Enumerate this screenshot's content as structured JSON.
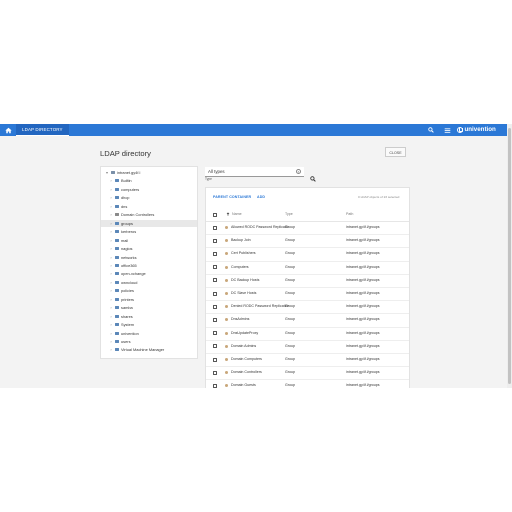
{
  "topbar": {
    "tab_label": "LDAP DIRECTORY",
    "brand": "univention",
    "colors": {
      "bar": "#2b78d6",
      "active_tab": "#2266c0"
    }
  },
  "page": {
    "title": "LDAP directory",
    "close_label": "CLOSE"
  },
  "tree": {
    "items": [
      {
        "label": "intranet.gy4f.l",
        "expanded": true,
        "icon": "domain-icon"
      },
      {
        "label": "Builtin",
        "icon": "folder-icon"
      },
      {
        "label": "computers",
        "icon": "folder-icon"
      },
      {
        "label": "dhcp",
        "icon": "folder-icon"
      },
      {
        "label": "dns",
        "icon": "folder-icon"
      },
      {
        "label": "Domain Controllers",
        "icon": "server-icon"
      },
      {
        "label": "groups",
        "icon": "folder-icon",
        "selected": true
      },
      {
        "label": "kerberos",
        "icon": "folder-icon"
      },
      {
        "label": "mail",
        "icon": "folder-icon"
      },
      {
        "label": "nagios",
        "icon": "folder-icon"
      },
      {
        "label": "networks",
        "icon": "folder-icon"
      },
      {
        "label": "office365",
        "icon": "folder-icon"
      },
      {
        "label": "open-xchange",
        "icon": "folder-icon"
      },
      {
        "label": "owncloud",
        "icon": "folder-icon"
      },
      {
        "label": "policies",
        "icon": "folder-icon"
      },
      {
        "label": "printers",
        "icon": "folder-icon"
      },
      {
        "label": "samba",
        "icon": "folder-icon"
      },
      {
        "label": "shares",
        "icon": "folder-icon"
      },
      {
        "label": "System",
        "icon": "folder-icon"
      },
      {
        "label": "univention",
        "icon": "folder-icon"
      },
      {
        "label": "users",
        "icon": "folder-icon"
      },
      {
        "label": "Virtual Machine Manager",
        "icon": "folder-icon"
      }
    ]
  },
  "filter": {
    "value": "All types",
    "label": "Type"
  },
  "grid": {
    "parent_label": "PARENT CONTAINER",
    "add_label": "ADD",
    "status": "0 LDAP objects of 23 selected",
    "columns": {
      "name": "Name",
      "type": "Type",
      "path": "Path"
    },
    "rows": [
      {
        "name": "Allowed RODC Password Replication Group",
        "type": "Group",
        "path": "intranet.gy4f.l/groups"
      },
      {
        "name": "Backup Join",
        "type": "Group",
        "path": "intranet.gy4f.l/groups"
      },
      {
        "name": "Cert Publishers",
        "type": "Group",
        "path": "intranet.gy4f.l/groups"
      },
      {
        "name": "Computers",
        "type": "Group",
        "path": "intranet.gy4f.l/groups"
      },
      {
        "name": "DC Backup Hosts",
        "type": "Group",
        "path": "intranet.gy4f.l/groups"
      },
      {
        "name": "DC Slave Hosts",
        "type": "Group",
        "path": "intranet.gy4f.l/groups"
      },
      {
        "name": "Denied RODC Password Replication Group",
        "type": "Group",
        "path": "intranet.gy4f.l/groups"
      },
      {
        "name": "DnsAdmins",
        "type": "Group",
        "path": "intranet.gy4f.l/groups"
      },
      {
        "name": "DnsUpdateProxy",
        "type": "Group",
        "path": "intranet.gy4f.l/groups"
      },
      {
        "name": "Domain Admins",
        "type": "Group",
        "path": "intranet.gy4f.l/groups"
      },
      {
        "name": "Domain Computers",
        "type": "Group",
        "path": "intranet.gy4f.l/groups"
      },
      {
        "name": "Domain Controllers",
        "type": "Group",
        "path": "intranet.gy4f.l/groups"
      },
      {
        "name": "Domain Guests",
        "type": "Group",
        "path": "intranet.gy4f.l/groups"
      }
    ]
  }
}
